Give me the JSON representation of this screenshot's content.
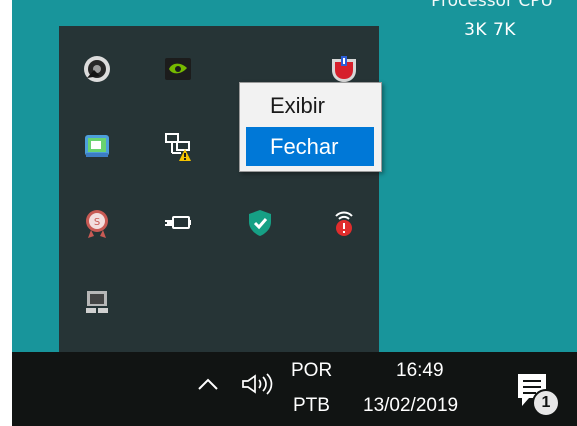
{
  "desktop": {
    "cutoff_text": "Processor CPU",
    "label": "3K 7K"
  },
  "tray": {
    "icons": [
      "speaker-icon",
      "nvidia-icon",
      "shield-notification-icon",
      "remote-desktop-icon",
      "network-warning-icon",
      "printer-icon",
      "usb-drive-icon",
      "seal-icon",
      "battery-plug-icon",
      "security-shield-icon",
      "alert-icon",
      "terminal-icon"
    ]
  },
  "context_menu": {
    "items": [
      "Exibir",
      "Fechar"
    ]
  },
  "taskbar": {
    "language_line1": "POR",
    "language_line2": "PTB",
    "time": "16:49",
    "date": "13/02/2019",
    "notification_count": "1"
  },
  "colors": {
    "desktop_bg": "#18959b",
    "tray_bg": "#263436",
    "taskbar_bg": "#111413",
    "menu_highlight": "#0078d7"
  }
}
